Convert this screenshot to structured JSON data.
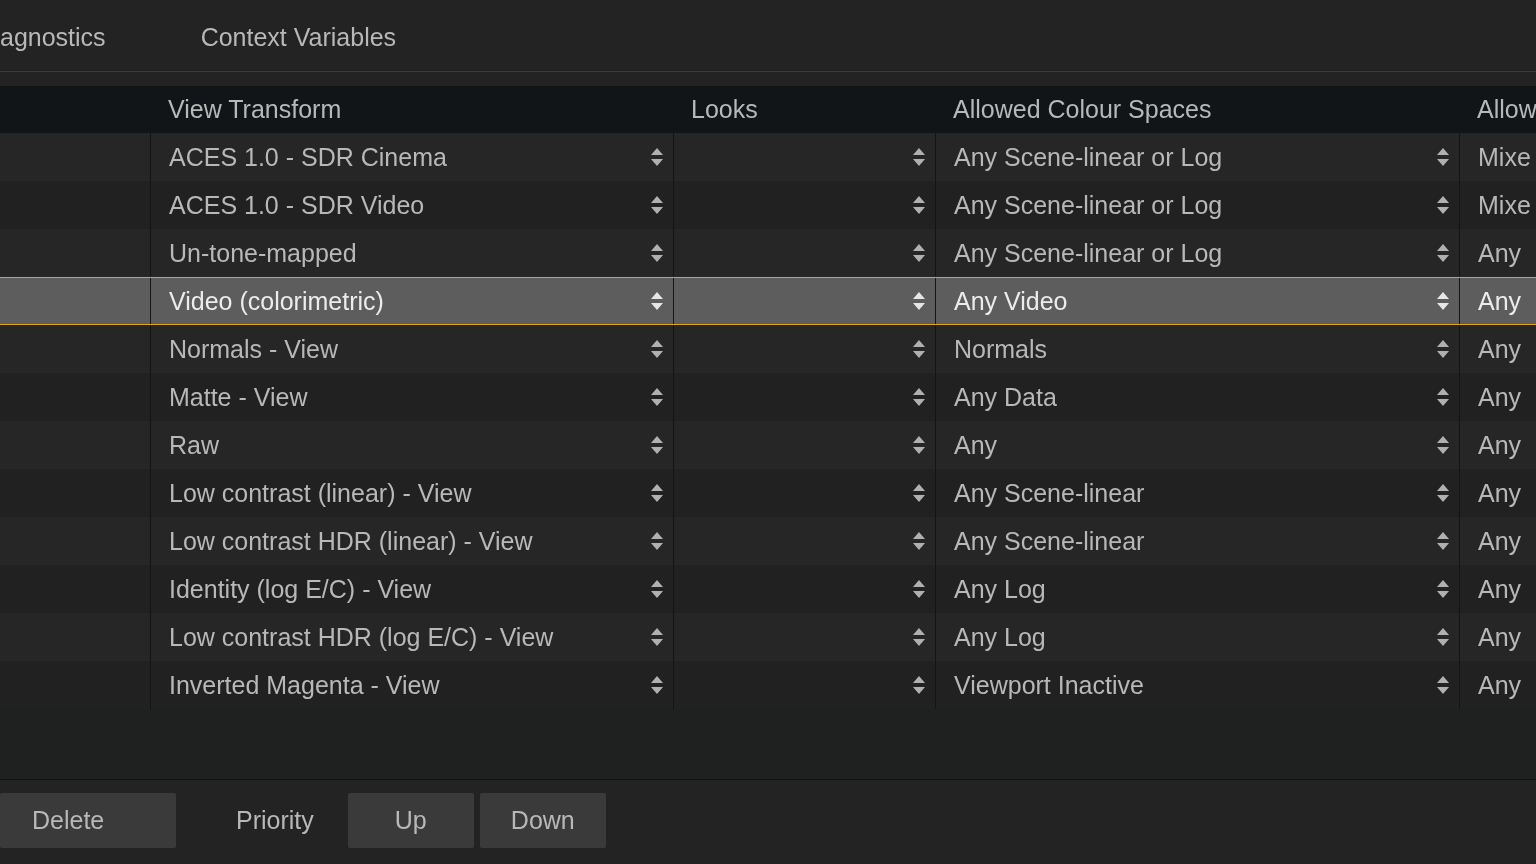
{
  "tabs": [
    {
      "label": "agnostics"
    },
    {
      "label": "Context Variables"
    }
  ],
  "table": {
    "columns": [
      "View Transform",
      "Looks",
      "Allowed Colour Spaces",
      "Allow"
    ],
    "rows": [
      {
        "view_transform": "ACES 1.0 - SDR Cinema",
        "allowed_colour_spaces": "Any Scene-linear or Log",
        "column_5": "Mixe",
        "selected": false
      },
      {
        "view_transform": "ACES 1.0 - SDR Video",
        "allowed_colour_spaces": "Any Scene-linear or Log",
        "column_5": "Mixe",
        "selected": false
      },
      {
        "view_transform": "Un-tone-mapped",
        "allowed_colour_spaces": "Any Scene-linear or Log",
        "column_5": "Any",
        "selected": false
      },
      {
        "view_transform": "Video (colorimetric)",
        "allowed_colour_spaces": "Any Video",
        "column_5": "Any",
        "selected": true
      },
      {
        "view_transform": "Normals - View",
        "allowed_colour_spaces": "Normals",
        "column_5": "Any",
        "selected": false
      },
      {
        "view_transform": "Matte - View",
        "allowed_colour_spaces": "Any Data",
        "column_5": "Any",
        "selected": false
      },
      {
        "view_transform": "Raw",
        "allowed_colour_spaces": "Any",
        "column_5": "Any",
        "selected": false
      },
      {
        "view_transform": "Low contrast (linear) - View",
        "allowed_colour_spaces": "Any Scene-linear",
        "column_5": "Any",
        "selected": false
      },
      {
        "view_transform": "Low contrast HDR (linear) - View",
        "allowed_colour_spaces": "Any Scene-linear",
        "column_5": "Any",
        "selected": false
      },
      {
        "view_transform": "Identity (log E/C) - View",
        "allowed_colour_spaces": "Any Log",
        "column_5": "Any",
        "selected": false
      },
      {
        "view_transform": "Low contrast HDR (log E/C) - View",
        "allowed_colour_spaces": "Any Log",
        "column_5": "Any",
        "selected": false
      },
      {
        "view_transform": "Inverted Magenta - View",
        "allowed_colour_spaces": "Viewport Inactive",
        "column_5": "Any",
        "selected": false
      }
    ]
  },
  "bottom_bar": {
    "delete_button": "Delete",
    "priority_label": "Priority",
    "up_button": "Up",
    "down_button": "Down"
  }
}
